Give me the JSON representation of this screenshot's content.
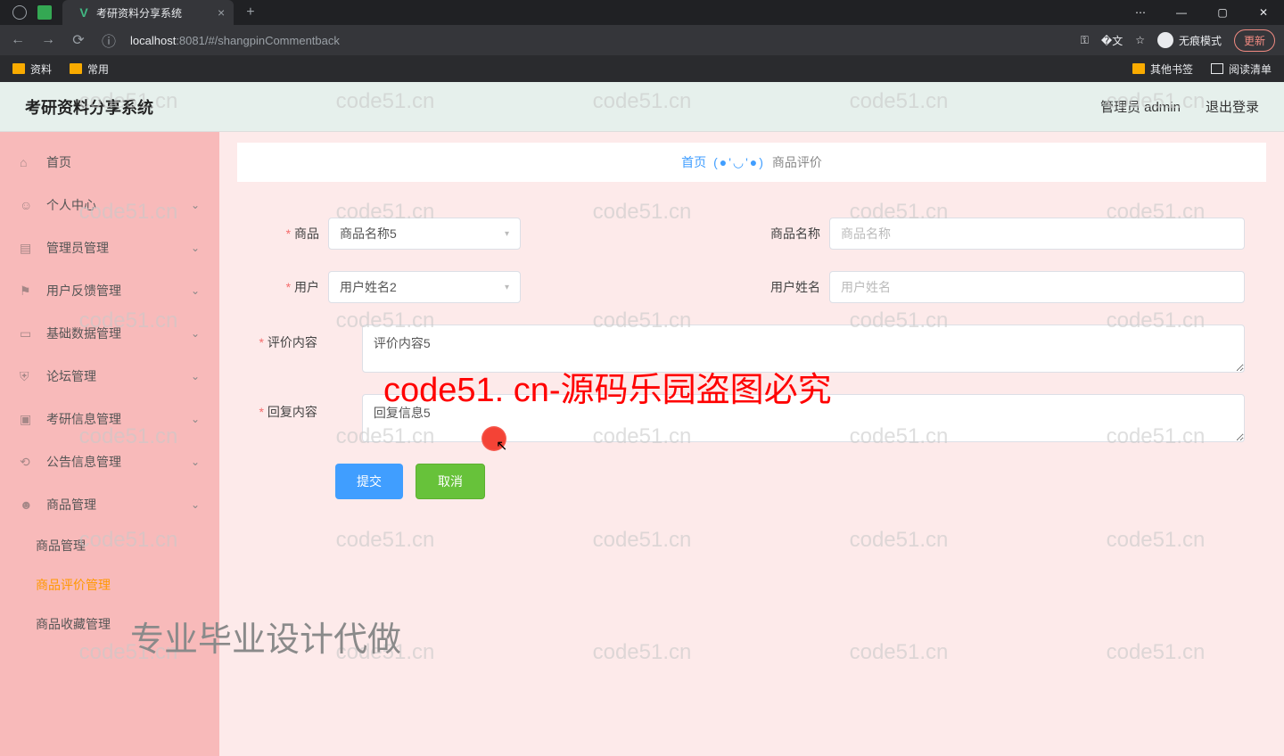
{
  "browser": {
    "tab_title": "考研资料分享系统",
    "url_host": "localhost",
    "url_port_path": ":8081/#/shangpinCommentback",
    "incognito_label": "无痕模式",
    "update_label": "更新",
    "bookmarks": {
      "left": [
        "资料",
        "常用"
      ],
      "right": [
        "其他书签",
        "阅读清单"
      ]
    }
  },
  "app": {
    "title": "考研资料分享系统",
    "header_user": "管理员 admin",
    "logout": "退出登录"
  },
  "sidebar": {
    "items": [
      {
        "label": "首页",
        "icon": "home"
      },
      {
        "label": "个人中心",
        "icon": "user",
        "expandable": true
      },
      {
        "label": "管理员管理",
        "icon": "clipboard",
        "expandable": true
      },
      {
        "label": "用户反馈管理",
        "icon": "flag",
        "expandable": true
      },
      {
        "label": "基础数据管理",
        "icon": "device",
        "expandable": true
      },
      {
        "label": "论坛管理",
        "icon": "shield",
        "expandable": true
      },
      {
        "label": "考研信息管理",
        "icon": "monitor",
        "expandable": true
      },
      {
        "label": "公告信息管理",
        "icon": "refresh",
        "expandable": true
      },
      {
        "label": "商品管理",
        "icon": "person",
        "expandable": true
      }
    ],
    "subs": [
      {
        "label": "商品管理",
        "active": false
      },
      {
        "label": "商品评价管理",
        "active": true
      },
      {
        "label": "商品收藏管理",
        "active": false
      }
    ]
  },
  "breadcrumb": {
    "home": "首页",
    "face": "(●'◡'●)",
    "current": "商品评价"
  },
  "form": {
    "product_label": "商品",
    "product_value": "商品名称5",
    "product_name_label": "商品名称",
    "product_name_placeholder": "商品名称",
    "user_label": "用户",
    "user_value": "用户姓名2",
    "user_name_label": "用户姓名",
    "user_name_placeholder": "用户姓名",
    "comment_label": "评价内容",
    "comment_value": "评价内容5",
    "reply_label": "回复内容",
    "reply_value": "回复信息5",
    "submit": "提交",
    "cancel": "取消"
  },
  "watermark": {
    "light": "code51.cn",
    "big": "code51. cn-源码乐园盗图必究",
    "slogan": "专业毕业设计代做"
  }
}
